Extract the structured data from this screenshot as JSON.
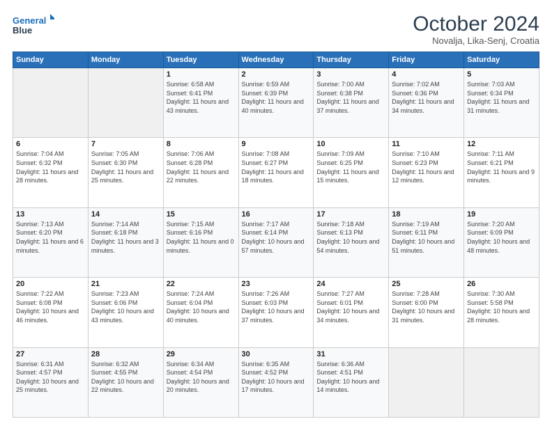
{
  "logo": {
    "line1": "General",
    "line2": "Blue"
  },
  "title": "October 2024",
  "location": "Novalja, Lika-Senj, Croatia",
  "days_of_week": [
    "Sunday",
    "Monday",
    "Tuesday",
    "Wednesday",
    "Thursday",
    "Friday",
    "Saturday"
  ],
  "weeks": [
    [
      {
        "day": "",
        "info": ""
      },
      {
        "day": "",
        "info": ""
      },
      {
        "day": "1",
        "info": "Sunrise: 6:58 AM\nSunset: 6:41 PM\nDaylight: 11 hours and 43 minutes."
      },
      {
        "day": "2",
        "info": "Sunrise: 6:59 AM\nSunset: 6:39 PM\nDaylight: 11 hours and 40 minutes."
      },
      {
        "day": "3",
        "info": "Sunrise: 7:00 AM\nSunset: 6:38 PM\nDaylight: 11 hours and 37 minutes."
      },
      {
        "day": "4",
        "info": "Sunrise: 7:02 AM\nSunset: 6:36 PM\nDaylight: 11 hours and 34 minutes."
      },
      {
        "day": "5",
        "info": "Sunrise: 7:03 AM\nSunset: 6:34 PM\nDaylight: 11 hours and 31 minutes."
      }
    ],
    [
      {
        "day": "6",
        "info": "Sunrise: 7:04 AM\nSunset: 6:32 PM\nDaylight: 11 hours and 28 minutes."
      },
      {
        "day": "7",
        "info": "Sunrise: 7:05 AM\nSunset: 6:30 PM\nDaylight: 11 hours and 25 minutes."
      },
      {
        "day": "8",
        "info": "Sunrise: 7:06 AM\nSunset: 6:28 PM\nDaylight: 11 hours and 22 minutes."
      },
      {
        "day": "9",
        "info": "Sunrise: 7:08 AM\nSunset: 6:27 PM\nDaylight: 11 hours and 18 minutes."
      },
      {
        "day": "10",
        "info": "Sunrise: 7:09 AM\nSunset: 6:25 PM\nDaylight: 11 hours and 15 minutes."
      },
      {
        "day": "11",
        "info": "Sunrise: 7:10 AM\nSunset: 6:23 PM\nDaylight: 11 hours and 12 minutes."
      },
      {
        "day": "12",
        "info": "Sunrise: 7:11 AM\nSunset: 6:21 PM\nDaylight: 11 hours and 9 minutes."
      }
    ],
    [
      {
        "day": "13",
        "info": "Sunrise: 7:13 AM\nSunset: 6:20 PM\nDaylight: 11 hours and 6 minutes."
      },
      {
        "day": "14",
        "info": "Sunrise: 7:14 AM\nSunset: 6:18 PM\nDaylight: 11 hours and 3 minutes."
      },
      {
        "day": "15",
        "info": "Sunrise: 7:15 AM\nSunset: 6:16 PM\nDaylight: 11 hours and 0 minutes."
      },
      {
        "day": "16",
        "info": "Sunrise: 7:17 AM\nSunset: 6:14 PM\nDaylight: 10 hours and 57 minutes."
      },
      {
        "day": "17",
        "info": "Sunrise: 7:18 AM\nSunset: 6:13 PM\nDaylight: 10 hours and 54 minutes."
      },
      {
        "day": "18",
        "info": "Sunrise: 7:19 AM\nSunset: 6:11 PM\nDaylight: 10 hours and 51 minutes."
      },
      {
        "day": "19",
        "info": "Sunrise: 7:20 AM\nSunset: 6:09 PM\nDaylight: 10 hours and 48 minutes."
      }
    ],
    [
      {
        "day": "20",
        "info": "Sunrise: 7:22 AM\nSunset: 6:08 PM\nDaylight: 10 hours and 46 minutes."
      },
      {
        "day": "21",
        "info": "Sunrise: 7:23 AM\nSunset: 6:06 PM\nDaylight: 10 hours and 43 minutes."
      },
      {
        "day": "22",
        "info": "Sunrise: 7:24 AM\nSunset: 6:04 PM\nDaylight: 10 hours and 40 minutes."
      },
      {
        "day": "23",
        "info": "Sunrise: 7:26 AM\nSunset: 6:03 PM\nDaylight: 10 hours and 37 minutes."
      },
      {
        "day": "24",
        "info": "Sunrise: 7:27 AM\nSunset: 6:01 PM\nDaylight: 10 hours and 34 minutes."
      },
      {
        "day": "25",
        "info": "Sunrise: 7:28 AM\nSunset: 6:00 PM\nDaylight: 10 hours and 31 minutes."
      },
      {
        "day": "26",
        "info": "Sunrise: 7:30 AM\nSunset: 5:58 PM\nDaylight: 10 hours and 28 minutes."
      }
    ],
    [
      {
        "day": "27",
        "info": "Sunrise: 6:31 AM\nSunset: 4:57 PM\nDaylight: 10 hours and 25 minutes."
      },
      {
        "day": "28",
        "info": "Sunrise: 6:32 AM\nSunset: 4:55 PM\nDaylight: 10 hours and 22 minutes."
      },
      {
        "day": "29",
        "info": "Sunrise: 6:34 AM\nSunset: 4:54 PM\nDaylight: 10 hours and 20 minutes."
      },
      {
        "day": "30",
        "info": "Sunrise: 6:35 AM\nSunset: 4:52 PM\nDaylight: 10 hours and 17 minutes."
      },
      {
        "day": "31",
        "info": "Sunrise: 6:36 AM\nSunset: 4:51 PM\nDaylight: 10 hours and 14 minutes."
      },
      {
        "day": "",
        "info": ""
      },
      {
        "day": "",
        "info": ""
      }
    ]
  ]
}
